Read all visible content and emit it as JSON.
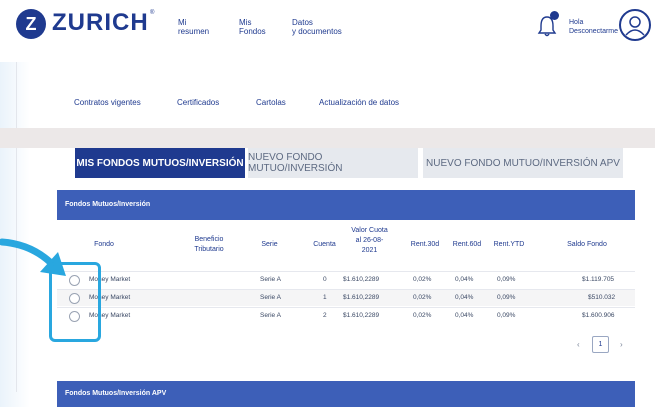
{
  "header": {
    "logo_mark": "Z",
    "logo_text": "ZURICH",
    "logo_reg": "®",
    "nav": [
      {
        "label": "Mi\nresumen"
      },
      {
        "label": "Mis\nFondos"
      },
      {
        "label": "Datos\ny documentos"
      }
    ],
    "user_text": "Hola\nDesconectarme",
    "icons": {
      "bell": "bell-icon",
      "avatar": "user-avatar-icon"
    }
  },
  "subnav": [
    "Contratos vigentes",
    "Certificados",
    "Cartolas",
    "Actualización de datos"
  ],
  "tabs": [
    {
      "label": "MIS FONDOS MUTUOS/INVERSIÓN",
      "active": true
    },
    {
      "label": "NUEVO FONDO MUTUO/INVERSIÓN",
      "active": false
    },
    {
      "label": "NUEVO FONDO MUTUO/INVERSIÓN APV",
      "active": false
    }
  ],
  "table": {
    "title": "Fondos Mutuos/Inversión",
    "columns": [
      "Fondo",
      "Beneficio\nTributario",
      "Serie",
      "Cuenta",
      "Valor Cuota\nal 26-08-\n2021",
      "Rent.30d",
      "Rent.60d",
      "Rent.YTD",
      "Saldo Fondo"
    ],
    "rows": [
      {
        "fondo": "Money Market",
        "beneficio": "",
        "serie": "Serie A",
        "cuenta": "0",
        "valor": "$1.610,2289",
        "r30": "0,02%",
        "r60": "0,04%",
        "ytd": "0,09%",
        "saldo": "$1.119.705"
      },
      {
        "fondo": "Money Market",
        "beneficio": "",
        "serie": "Serie A",
        "cuenta": "1",
        "valor": "$1.610,2289",
        "r30": "0,02%",
        "r60": "0,04%",
        "ytd": "0,09%",
        "saldo": "$510.032"
      },
      {
        "fondo": "Money Market",
        "beneficio": "",
        "serie": "Serie A",
        "cuenta": "2",
        "valor": "$1.610,2289",
        "r30": "0,02%",
        "r60": "0,04%",
        "ytd": "0,09%",
        "saldo": "$1.600.906"
      }
    ]
  },
  "pager": {
    "prev": "‹",
    "page": "1",
    "next": "›"
  },
  "table2": {
    "title": "Fondos Mutuos/Inversión APV"
  },
  "colors": {
    "brand": "#1f3a8f",
    "panel_header": "#3d5fb8",
    "highlight": "#29a7df"
  }
}
